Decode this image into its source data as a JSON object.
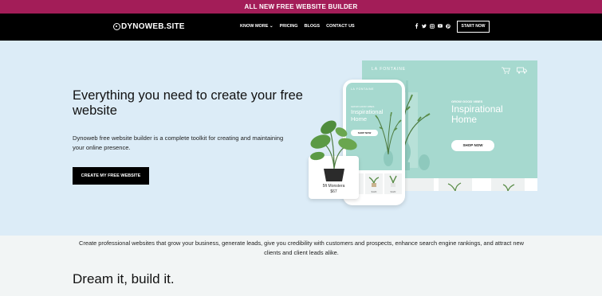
{
  "promo_bar": {
    "text": "ALL NEW FREE WEBSITE BUILDER"
  },
  "nav": {
    "logo": "DYNOWEB.SITE",
    "menu": [
      {
        "label": "KNOW MORE ⌄"
      },
      {
        "label": "PRICING"
      },
      {
        "label": "BLOGS"
      },
      {
        "label": "CONTACT US"
      }
    ],
    "socials": [
      "facebook-icon",
      "twitter-icon",
      "instagram-icon",
      "youtube-icon",
      "pinterest-icon"
    ],
    "start_button": "START NOW"
  },
  "hero": {
    "title": "Everything you need to create your free website",
    "subtitle": "Dynoweb free website builder is a complete toolkit for creating and maintaining your online presence.",
    "cta": "CREATE MY FREE WEBSITE"
  },
  "mockup": {
    "desktop": {
      "brand": "LA FONTAINE",
      "small": "GROW GOOD VIBES",
      "heading": "Inspirational Home",
      "shop": "SHOP NOW"
    },
    "phone": {
      "brand": "LA FONTAINE",
      "small": "GROW GOOD VIBES",
      "heading": "Inspirational Home",
      "shop": "SHOP NOW",
      "prices": [
        "$120",
        "$120",
        "$120"
      ]
    },
    "plant_card": {
      "name": "5ft Monstera",
      "price": "$67"
    }
  },
  "intro": "Create professional websites that grow your business, generate leads, give you credibility with customers and prospects, enhance search engine rankings, and attract new clients and client leads alike.",
  "section_title": "Dream it, build it.",
  "colors": {
    "promo": "#a31d58",
    "nav": "#000000",
    "hero_bg": "#dcecf7",
    "mint": "#a6d9cf"
  }
}
